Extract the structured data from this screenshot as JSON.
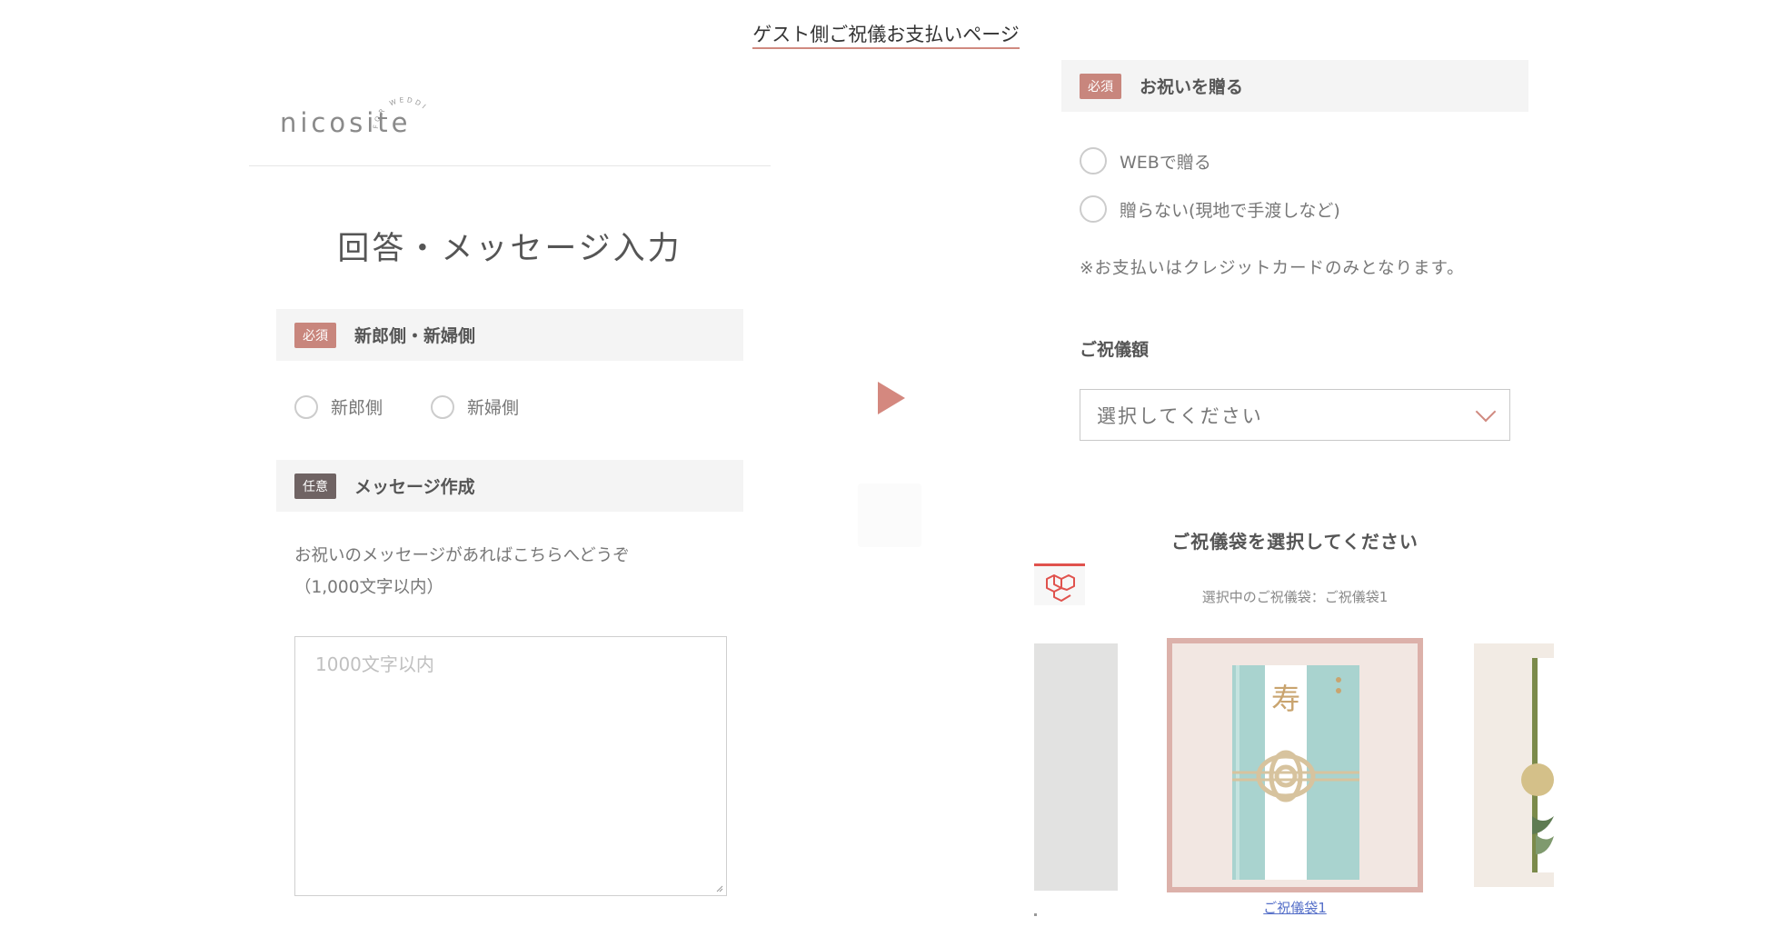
{
  "page_caption": "ゲスト側ご祝儀お支払いページ",
  "logo": {
    "word": "nicosite",
    "arc_text": "FOR WEDDING"
  },
  "form": {
    "title": "回答・メッセージ入力",
    "side_section": {
      "badge": "必須",
      "label": "新郎側・新婦側",
      "options": [
        "新郎側",
        "新婦側"
      ]
    },
    "message_section": {
      "badge": "任意",
      "label": "メッセージ作成",
      "help_line1": "お祝いのメッセージがあればこちらへどうぞ",
      "help_line2": "（1,000文字以内）",
      "placeholder": "1000文字以内"
    }
  },
  "gift": {
    "section": {
      "badge": "必須",
      "label": "お祝いを贈る",
      "options": [
        "WEBで贈る",
        "贈らない(現地で手渡しなど)"
      ]
    },
    "note": "※お支払いはクレジットカードのみとなります。",
    "amount_label": "ご祝儀額",
    "amount_select": "選択してください"
  },
  "envelope": {
    "title": "ご祝儀袋を選択してください",
    "selected_text": "選択中のご祝儀袋：ご祝儀袋1",
    "main_char": "寿",
    "caption": "ご祝儀袋1"
  },
  "icons": {
    "arrow": "play-arrow-icon",
    "chevron": "chevron-down-icon",
    "tab": "laravel-logo-icon"
  },
  "colors": {
    "accent": "#d4887f",
    "required_badge": "#c8867d",
    "optional_badge": "#6f6363",
    "envelope_frame": "#dcb1aa",
    "envelope_body": "#a9d3cf"
  }
}
